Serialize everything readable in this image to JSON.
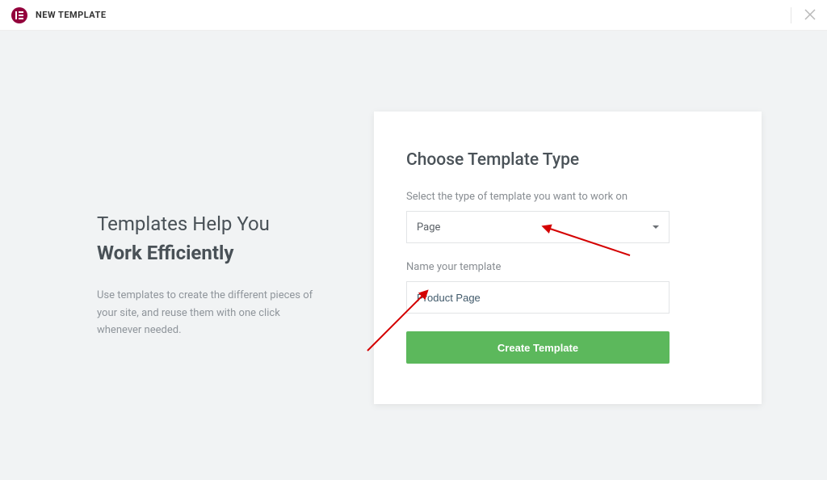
{
  "header": {
    "title": "NEW TEMPLATE"
  },
  "left": {
    "heading_line1": "Templates Help You",
    "heading_line2": "Work Efficiently",
    "body": "Use templates to create the different pieces of your site, and reuse them with one click whenever needed."
  },
  "card": {
    "title": "Choose Template Type",
    "type_label": "Select the type of template you want to work on",
    "type_value": "Page",
    "name_label": "Name your template",
    "name_value": "Product Page",
    "create_label": "Create Template"
  }
}
